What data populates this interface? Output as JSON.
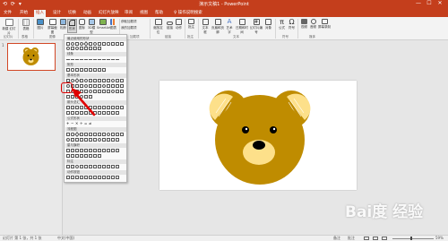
{
  "app": {
    "title": "演示文稿1 - PowerPoint",
    "qat": "⟲ ⟳ ▾"
  },
  "window": {
    "minimize": "—",
    "maximize": "☐",
    "close": "✕"
  },
  "tabs": [
    {
      "label": "文件"
    },
    {
      "label": "开始"
    },
    {
      "label": "插入",
      "active": true
    },
    {
      "label": "设计"
    },
    {
      "label": "切换"
    },
    {
      "label": "动画"
    },
    {
      "label": "幻灯片放映"
    },
    {
      "label": "审阅"
    },
    {
      "label": "视图"
    },
    {
      "label": "帮助"
    },
    {
      "label": "♀ 操作说明搜索"
    }
  ],
  "ribbon": {
    "new_slide": "新建\n幻灯片",
    "table": "表格",
    "images": "图片",
    "screenshot": "屏幕截图",
    "album": "相册",
    "shapes": "形状",
    "icons": "图标",
    "models": "3D模型",
    "smartart": "SmartArt",
    "chart": "图表",
    "addins_get": "获取加载项",
    "addins_my": "我的加载项",
    "zoom": "缩放定位",
    "link": "链接",
    "action": "动作",
    "comment": "批注",
    "textbox": "文本框",
    "header_footer": "页眉和页脚",
    "wordart": "艺术字",
    "date_time": "日期和时间",
    "slide_number": "幻灯片编号",
    "object": "对象",
    "equation": "公式",
    "symbol": "符号",
    "video": "视频",
    "audio": "音频",
    "screen_record": "屏幕录制",
    "groups": {
      "slides": "幻灯片",
      "tables": "表格",
      "images": "图像",
      "addins": "加载项",
      "links": "链接",
      "comments": "批注",
      "text": "文本",
      "symbols": "符号",
      "media": "媒体"
    }
  },
  "shape_menu": {
    "sections": [
      {
        "name": "最近使用的形状"
      },
      {
        "name": "线条"
      },
      {
        "name": "矩形"
      },
      {
        "name": "基本形状"
      },
      {
        "name": "箭头总汇"
      },
      {
        "name": "公式形状"
      },
      {
        "name": "流程图"
      },
      {
        "name": "星与旗帜"
      },
      {
        "name": "标注"
      },
      {
        "name": "动作按钮"
      }
    ]
  },
  "slides": {
    "number": "1"
  },
  "status": {
    "left": "幻灯片 第 1 张，共 1 张",
    "lang": "中文(中国)",
    "notes": "备注",
    "comments": "批注",
    "zoom": "59%"
  },
  "watermark": "Bai度 经验",
  "colors": {
    "accent": "#c43e1c",
    "bear_fur": "#bf8c00",
    "bear_inner": "#fde08a",
    "highlight": "#e00000"
  }
}
